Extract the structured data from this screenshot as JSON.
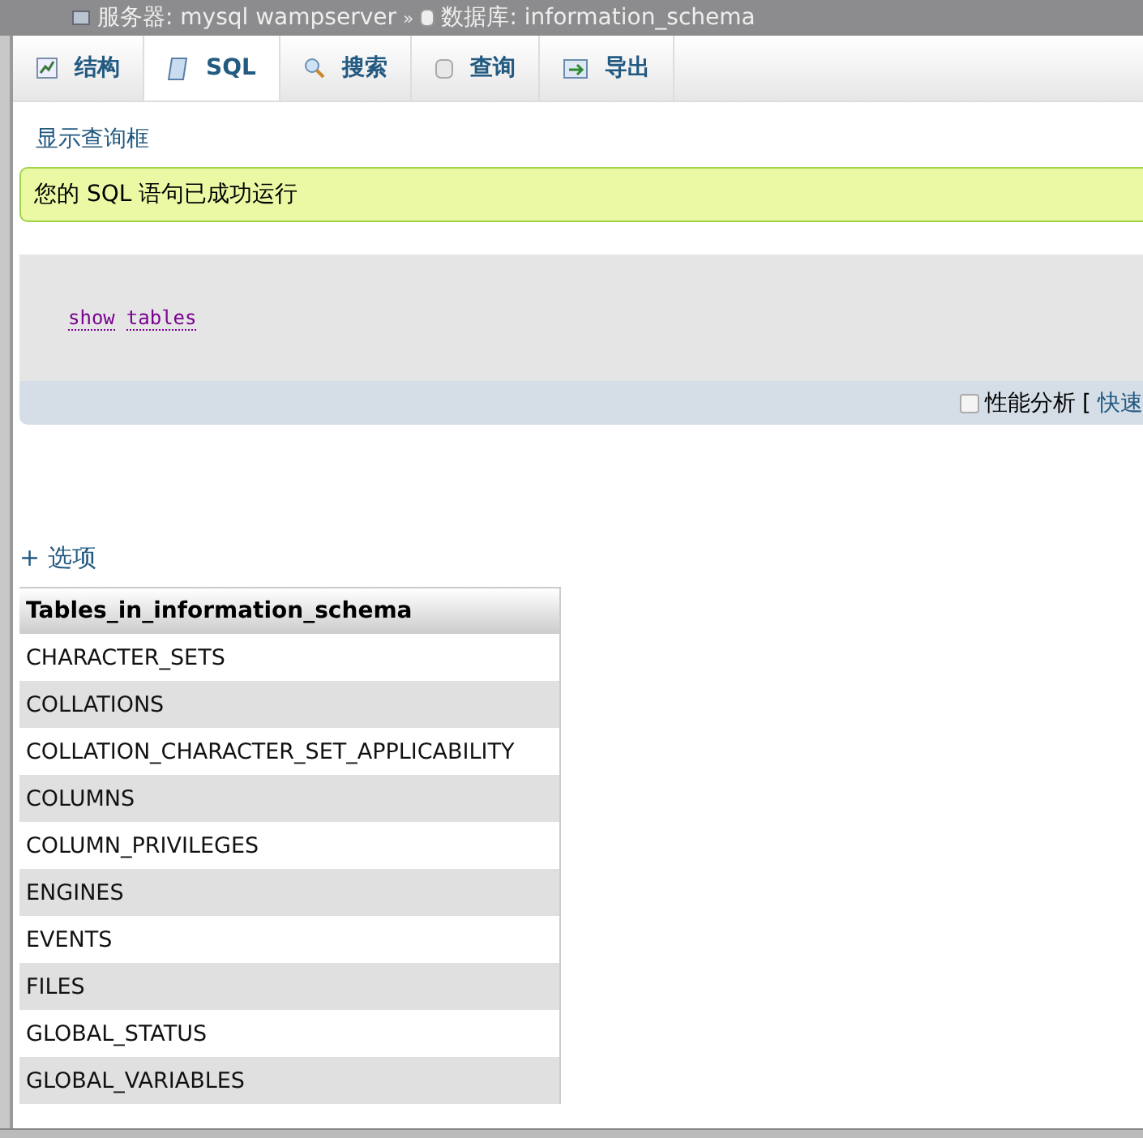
{
  "breadcrumb": {
    "server": "服务器: mysql wampserver",
    "separator": "»",
    "database": "数据库: information_schema"
  },
  "tabs": [
    {
      "label": "结构",
      "kind": "structure",
      "selected": false
    },
    {
      "label": "SQL",
      "kind": "sql",
      "selected": true
    },
    {
      "label": "搜索",
      "kind": "search",
      "selected": false
    },
    {
      "label": "查询",
      "kind": "query",
      "selected": false
    },
    {
      "label": "导出",
      "kind": "export",
      "selected": false
    }
  ],
  "show_query_link": "显示查询框",
  "success_message": "您的 SQL 语句已成功运行",
  "sql": [
    "show",
    "tables"
  ],
  "profiling": {
    "checked": false,
    "label": "性能分析",
    "bracket": "[",
    "link": "快速"
  },
  "options_link": "+ 选项",
  "table": {
    "column": "Tables_in_information_schema",
    "rows": [
      "CHARACTER_SETS",
      "COLLATIONS",
      "COLLATION_CHARACTER_SET_APPLICABILITY",
      "COLUMNS",
      "COLUMN_PRIVILEGES",
      "ENGINES",
      "EVENTS",
      "FILES",
      "GLOBAL_STATUS",
      "GLOBAL_VARIABLES"
    ]
  }
}
